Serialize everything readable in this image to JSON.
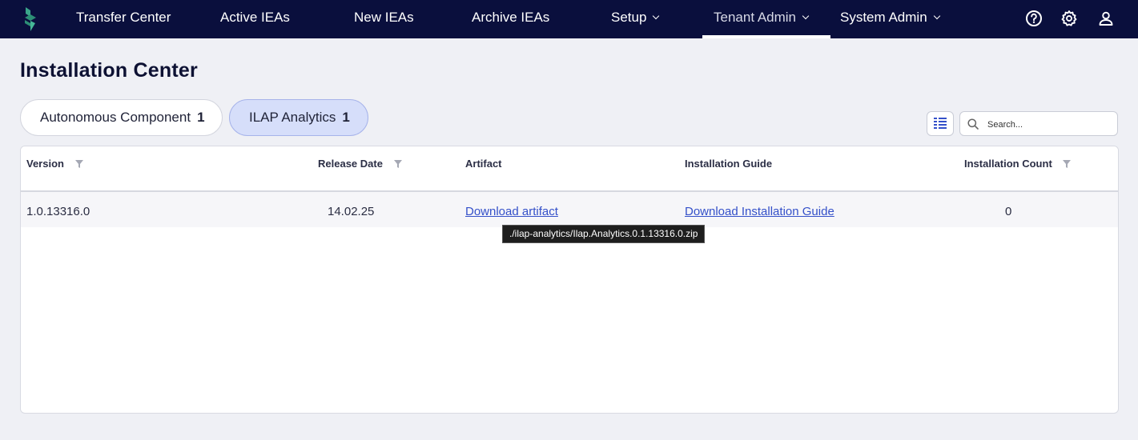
{
  "nav": {
    "items": [
      {
        "label": "Transfer Center"
      },
      {
        "label": "Active IEAs"
      },
      {
        "label": "New IEAs"
      },
      {
        "label": "Archive IEAs"
      },
      {
        "label": "Setup"
      },
      {
        "label": "Tenant Admin"
      },
      {
        "label": "System Admin"
      }
    ],
    "icons": [
      "help-icon",
      "gear-icon",
      "user-icon"
    ],
    "brand_color": "#0a0f3d"
  },
  "page": {
    "title": "Installation Center"
  },
  "tabs": [
    {
      "label": "Autonomous Component",
      "count": "1"
    },
    {
      "label": "ILAP Analytics",
      "count": "1",
      "selected": true
    }
  ],
  "search": {
    "placeholder": "Search..."
  },
  "table": {
    "columns": [
      "Version",
      "Release Date",
      "Artifact",
      "Installation Guide",
      "Installation Count"
    ],
    "rows": [
      {
        "version": "1.0.13316.0",
        "release_date": "14.02.25",
        "artifact": "Download artifact",
        "guide": "Download Installation Guide",
        "count": "0"
      }
    ]
  },
  "tooltip": {
    "text": "./ilap-analytics/Ilap.Analytics.0.1.13316.0.zip"
  },
  "colors": {
    "accent": "#3450c9",
    "selected_tab": "#d6defa",
    "background": "#eff0f5"
  }
}
